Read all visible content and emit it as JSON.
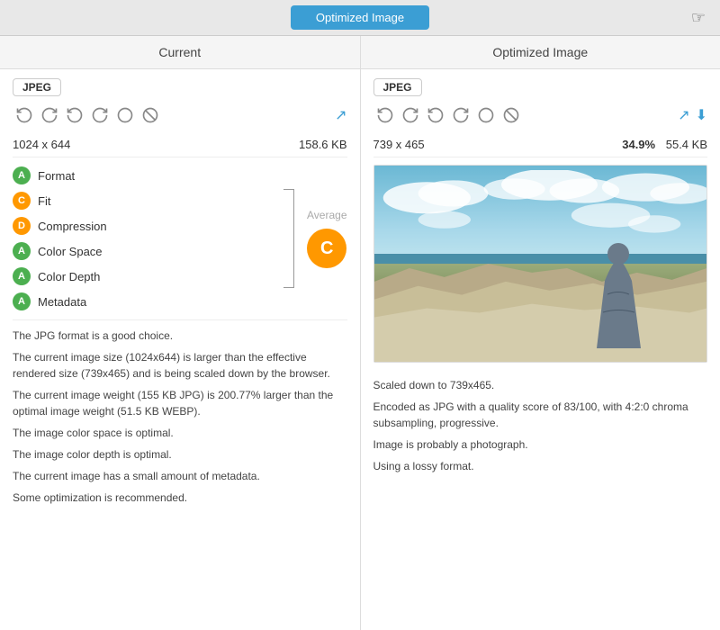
{
  "topBar": {
    "tabLabel": "Optimized Image",
    "cursorIcon": "🖱"
  },
  "panels": {
    "current": {
      "header": "Current",
      "format": "JPEG",
      "dimensions": "1024 x 644",
      "fileSize": "158.6 KB",
      "settings": [
        {
          "label": "Format",
          "badgeColor": "green",
          "badgeLetter": "A"
        },
        {
          "label": "Fit",
          "badgeColor": "orange",
          "badgeLetter": "C"
        },
        {
          "label": "Compression",
          "badgeColor": "orange",
          "badgeLetter": "D"
        },
        {
          "label": "Color Space",
          "badgeColor": "green",
          "badgeLetter": "A"
        },
        {
          "label": "Color Depth",
          "badgeColor": "green",
          "badgeLetter": "A"
        },
        {
          "label": "Metadata",
          "badgeColor": "green",
          "badgeLetter": "A"
        }
      ],
      "averageLabel": "Average",
      "gradeLabel": "C",
      "descriptions": [
        "The JPG format is a good choice.",
        "The current image size (1024x644) is larger than the effective rendered size (739x465) and is being scaled down by the browser.",
        "The current image weight (155 KB JPG) is 200.77% larger than the optimal image weight (51.5 KB WEBP).",
        "The image color space is optimal.",
        "The image color depth is optimal.",
        "The current image has a small amount of metadata.",
        "Some optimization is recommended."
      ]
    },
    "optimized": {
      "header": "Optimized Image",
      "format": "JPEG",
      "dimensions": "739 x 465",
      "savingPct": "34.9%",
      "fileSize": "55.4 KB",
      "descriptions": [
        "Scaled down to 739x465.",
        "Encoded as JPG with a quality score of 83/100, with 4:2:0 chroma subsampling, progressive.",
        "Image is probably a photograph.",
        "Using a lossy format."
      ]
    }
  },
  "icons": {
    "toolIcons": [
      "↺",
      "↻",
      "↺",
      "↻",
      "○",
      "⊘"
    ],
    "externalLink": "⧉",
    "download": "⬇"
  }
}
